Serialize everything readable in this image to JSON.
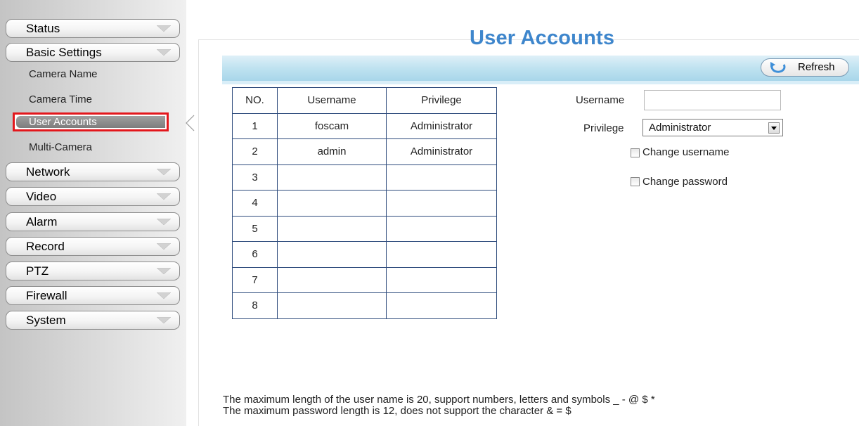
{
  "sidebar": {
    "menu": {
      "status": "Status",
      "basic_settings": "Basic Settings",
      "network": "Network",
      "video": "Video",
      "alarm": "Alarm",
      "record": "Record",
      "ptz": "PTZ",
      "firewall": "Firewall",
      "system": "System"
    },
    "basic_sub": {
      "camera_name": "Camera Name",
      "camera_time": "Camera Time",
      "user_accounts": "User Accounts",
      "multi_camera": "Multi-Camera"
    }
  },
  "page": {
    "title": "User Accounts",
    "refresh_label": "Refresh"
  },
  "table": {
    "headers": [
      "NO.",
      "Username",
      "Privilege"
    ],
    "rows": [
      {
        "no": "1",
        "username": "foscam",
        "privilege": "Administrator"
      },
      {
        "no": "2",
        "username": "admin",
        "privilege": "Administrator"
      },
      {
        "no": "3",
        "username": "",
        "privilege": ""
      },
      {
        "no": "4",
        "username": "",
        "privilege": ""
      },
      {
        "no": "5",
        "username": "",
        "privilege": ""
      },
      {
        "no": "6",
        "username": "",
        "privilege": ""
      },
      {
        "no": "7",
        "username": "",
        "privilege": ""
      },
      {
        "no": "8",
        "username": "",
        "privilege": ""
      }
    ]
  },
  "form": {
    "username_label": "Username",
    "username_value": "",
    "privilege_label": "Privilege",
    "privilege_selected": "Administrator",
    "change_username_label": "Change username",
    "change_password_label": "Change password"
  },
  "notes": {
    "line1": "The maximum length of the user name is 20, support numbers, letters and symbols _ - @ $ *",
    "line2": "The maximum password length is 12, does not support the character & = $"
  },
  "colors": {
    "title_blue": "#3e86cc",
    "highlight_red": "#e3171c",
    "table_border": "#2e4b7c",
    "toolbar_blue": "#bfe2f0"
  }
}
